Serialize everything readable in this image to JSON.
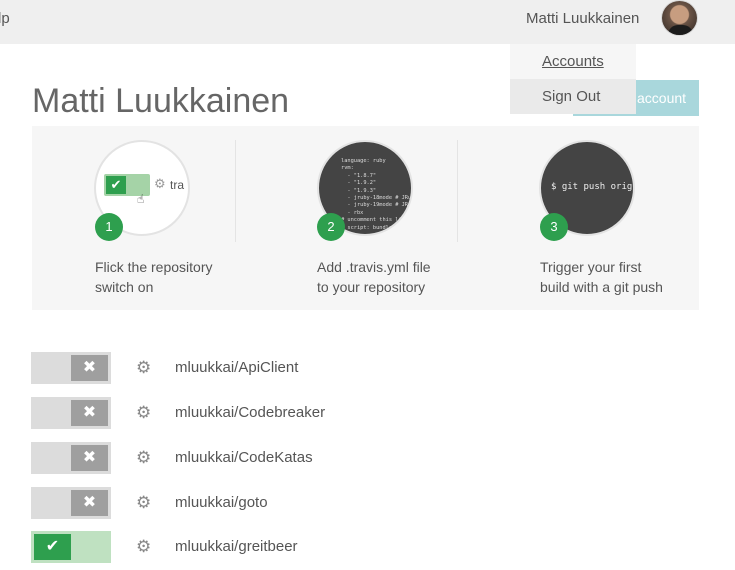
{
  "header": {
    "left_fragment": "lp",
    "username": "Matti Luukkainen"
  },
  "dropdown": {
    "items": [
      {
        "label": "Accounts"
      },
      {
        "label": "Sign Out"
      }
    ]
  },
  "page": {
    "title": "Matti Luukkainen",
    "sync_button_partial": "account"
  },
  "steps": [
    {
      "number": "1",
      "line1": "Flick the repository",
      "line2": "switch on",
      "illustration_text": "tra"
    },
    {
      "number": "2",
      "line1": "Add .travis.yml file",
      "line2": "to your repository",
      "illustration_code": "language: ruby\nrvm:\n  - \"1.8.7\"\n  - \"1.9.2\"\n  - \"1.9.3\"\n  - jruby-18mode # JRub\n  - jruby-19mode # JRub\n  - rbx\n# uncomment this li\n# script: bundle e"
    },
    {
      "number": "3",
      "line1": "Trigger your first",
      "line2": "build with a git push",
      "illustration_code": "$ git push origin"
    }
  ],
  "repositories": [
    {
      "name": "mluukkai/ApiClient",
      "enabled": false
    },
    {
      "name": "mluukkai/Codebreaker",
      "enabled": false
    },
    {
      "name": "mluukkai/CodeKatas",
      "enabled": false
    },
    {
      "name": "mluukkai/goto",
      "enabled": false
    },
    {
      "name": "mluukkai/greitbeer",
      "enabled": true
    }
  ],
  "icons": {
    "check": "✔",
    "cross": "✖",
    "gear": "⚙",
    "hand": "☝"
  },
  "colors": {
    "accent_green": "#2e9f4e",
    "sync_button": "#a9d7dc",
    "topbar": "#efefef"
  }
}
